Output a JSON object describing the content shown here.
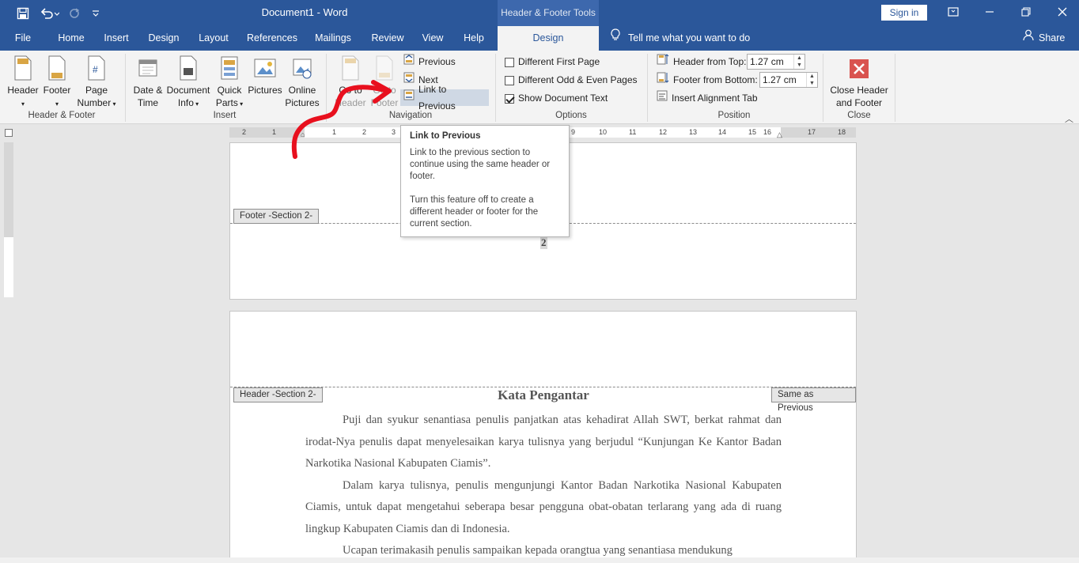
{
  "window": {
    "doc_title": "Document1  -  Word",
    "contextual_tab": "Header & Footer Tools",
    "sign_in": "Sign in"
  },
  "tabs": [
    "File",
    "Home",
    "Insert",
    "Design",
    "Layout",
    "References",
    "Mailings",
    "Review",
    "View",
    "Help"
  ],
  "active_tab": "Design",
  "tell_me": "Tell me what you want to do",
  "share": "Share",
  "ribbon": {
    "group_hf": {
      "label": "Header & Footer",
      "header": "Header",
      "footer": "Footer",
      "page_number_1": "Page",
      "page_number_2": "Number"
    },
    "group_insert": {
      "label": "Insert",
      "date_1": "Date &",
      "date_2": "Time",
      "docinfo_1": "Document",
      "docinfo_2": "Info",
      "quick_1": "Quick",
      "quick_2": "Parts",
      "pictures": "Pictures",
      "online_1": "Online",
      "online_2": "Pictures"
    },
    "group_nav": {
      "label": "Navigation",
      "goto_header_1": "Go to",
      "goto_header_2": "Header",
      "goto_footer_1": "Go to",
      "goto_footer_2": "Footer",
      "previous": "Previous",
      "next": "Next",
      "link_prev": "Link to Previous"
    },
    "group_options": {
      "label": "Options",
      "diff_first": "Different First Page",
      "diff_odd": "Different Odd & Even Pages",
      "show_text": "Show Document Text",
      "diff_first_checked": false,
      "diff_odd_checked": false,
      "show_text_checked": true
    },
    "group_position": {
      "label": "Position",
      "header_top": "Header from Top:",
      "header_top_val": "1.27 cm",
      "footer_bottom": "Footer from Bottom:",
      "footer_bottom_val": "1.27 cm",
      "align_tab": "Insert Alignment Tab"
    },
    "group_close": {
      "label": "Close",
      "close_1": "Close Header",
      "close_2": "and Footer"
    }
  },
  "tooltip": {
    "title": "Link to Previous",
    "p1": "Link to the previous section to continue using the same header or footer.",
    "p2": "Turn this feature off to create a different header or footer for the current section."
  },
  "ruler_numbers": [
    "2",
    "1",
    "1",
    "2",
    "3",
    "9",
    "10",
    "11",
    "12",
    "13",
    "14",
    "15",
    "16",
    "17",
    "18"
  ],
  "page1": {
    "footer_tag": "Footer -Section 2-",
    "page_number": "2"
  },
  "page2": {
    "header_tag": "Header -Section 2-",
    "same_as_previous": "Same as Previous",
    "heading": "Kata Pengantar",
    "paragraphs": [
      "Puji dan syukur senantiasa penulis panjatkan atas kehadirat Allah SWT, berkat rahmat dan irodat-Nya penulis dapat menyelesaikan karya tulisnya yang berjudul “Kunjungan Ke Kantor Badan Narkotika Nasional Kabupaten Ciamis”.",
      "Dalam karya tulisnya, penulis mengunjungi Kantor Badan Narkotika Nasional Kabupaten Ciamis, untuk dapat mengetahui seberapa besar pengguna obat-obatan terlarang yang ada di ruang lingkup Kabupaten Ciamis dan di Indonesia.",
      "Ucapan terimakasih penulis sampaikan kepada orangtua yang senantiasa mendukung"
    ]
  },
  "colors": {
    "brand": "#2b579a",
    "ribbon": "#f3f3f3",
    "annotation": "#e8101e"
  }
}
